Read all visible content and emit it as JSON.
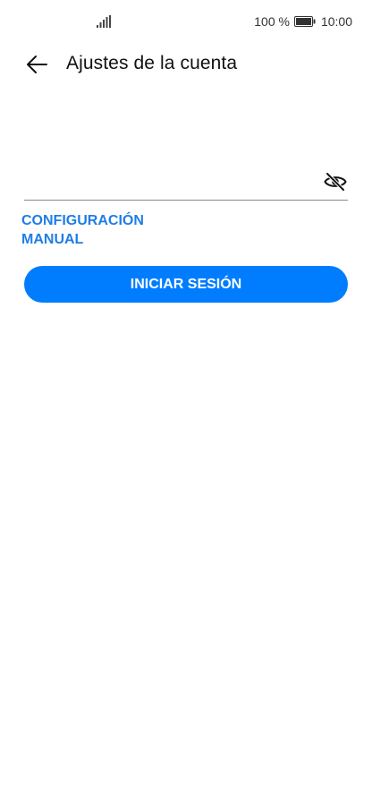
{
  "status_bar": {
    "battery_percent": "100 %",
    "time": "10:00",
    "icons": [
      "signal-icon",
      "battery-icon"
    ]
  },
  "app_bar": {
    "back_icon": "back-arrow-icon",
    "title": "Ajustes de la cuenta"
  },
  "password_field": {
    "value": "",
    "placeholder": "",
    "toggle_icon": "eye-off-icon"
  },
  "manual_config": {
    "label": "CONFIGURACIÓN MANUAL"
  },
  "signin_button": {
    "label": "INICIAR SESIÓN"
  },
  "colors": {
    "accent": "#007dff",
    "link": "#1f7de6",
    "background": "#ffffff",
    "divider": "#8a8a8a"
  }
}
